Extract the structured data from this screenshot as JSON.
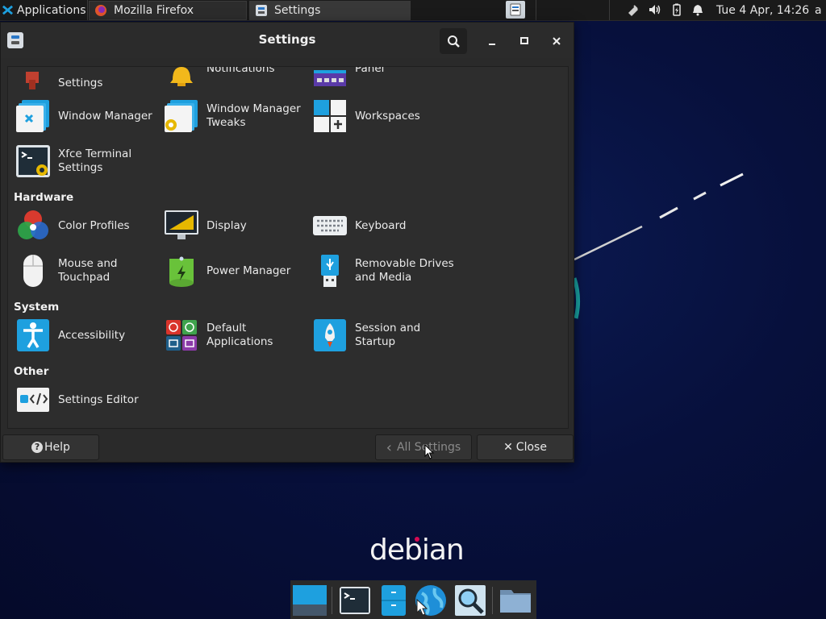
{
  "top_panel": {
    "applications_label": "Applications",
    "apps_menu_glyph": "≡",
    "tasks": [
      {
        "label": "Mozilla Firefox",
        "icon": "firefox-icon"
      },
      {
        "label": "Settings",
        "icon": "settings-app-icon"
      }
    ],
    "tray_icons": [
      "network-icon",
      "volume-icon",
      "battery-icon",
      "notification-bell-icon"
    ],
    "clock": "Tue  4 Apr, 14:26",
    "user_initial": "a"
  },
  "window": {
    "title": "Settings",
    "buttons": {
      "search": "search-icon",
      "minimize": "–",
      "maximize": "□",
      "close": "✕"
    }
  },
  "sections": {
    "personal_partial": [
      {
        "label": "Settings",
        "icon": "input-method-icon"
      },
      {
        "label": "Notifications",
        "icon": "notification-bell-icon"
      },
      {
        "label": "Panel",
        "icon": "panel-icon"
      },
      {
        "label": "Window Manager",
        "icon": "window-manager-icon"
      },
      {
        "label": "Window Manager\nTweaks",
        "icon": "window-manager-tweaks-icon"
      },
      {
        "label": "Workspaces",
        "icon": "workspaces-icon"
      },
      {
        "label": "Xfce Terminal\nSettings",
        "icon": "terminal-settings-icon"
      }
    ],
    "hardware": {
      "title": "Hardware",
      "items": [
        {
          "label": "Color Profiles",
          "icon": "color-profiles-icon"
        },
        {
          "label": "Display",
          "icon": "display-icon"
        },
        {
          "label": "Keyboard",
          "icon": "keyboard-icon"
        },
        {
          "label": "Mouse and\nTouchpad",
          "icon": "mouse-icon"
        },
        {
          "label": "Power Manager",
          "icon": "battery-icon"
        },
        {
          "label": "Removable Drives\nand Media",
          "icon": "usb-drive-icon"
        }
      ]
    },
    "system": {
      "title": "System",
      "items": [
        {
          "label": "Accessibility",
          "icon": "accessibility-icon"
        },
        {
          "label": "Default\nApplications",
          "icon": "default-applications-icon"
        },
        {
          "label": "Session and\nStartup",
          "icon": "rocket-icon"
        }
      ]
    },
    "other": {
      "title": "Other",
      "items": [
        {
          "label": "Settings Editor",
          "icon": "settings-editor-icon"
        }
      ]
    }
  },
  "footer": {
    "help_label": "Help",
    "help_glyph": "?",
    "all_settings_label": "All Settings",
    "all_settings_glyph": "‹",
    "close_label": "Close",
    "close_glyph": "✕"
  },
  "desktop": {
    "logo_text": "debian",
    "dock_icons": [
      "show-desktop-icon",
      "terminal-icon",
      "file-manager-icon",
      "web-browser-icon",
      "app-finder-icon",
      "folder-icon"
    ]
  },
  "colors": {
    "panel_bg": "#1a1a1a",
    "window_bg": "#2a2a2a",
    "accent_blue": "#1ea0df",
    "debian_red": "#d70a53",
    "desktop_bg": "#07103c"
  }
}
